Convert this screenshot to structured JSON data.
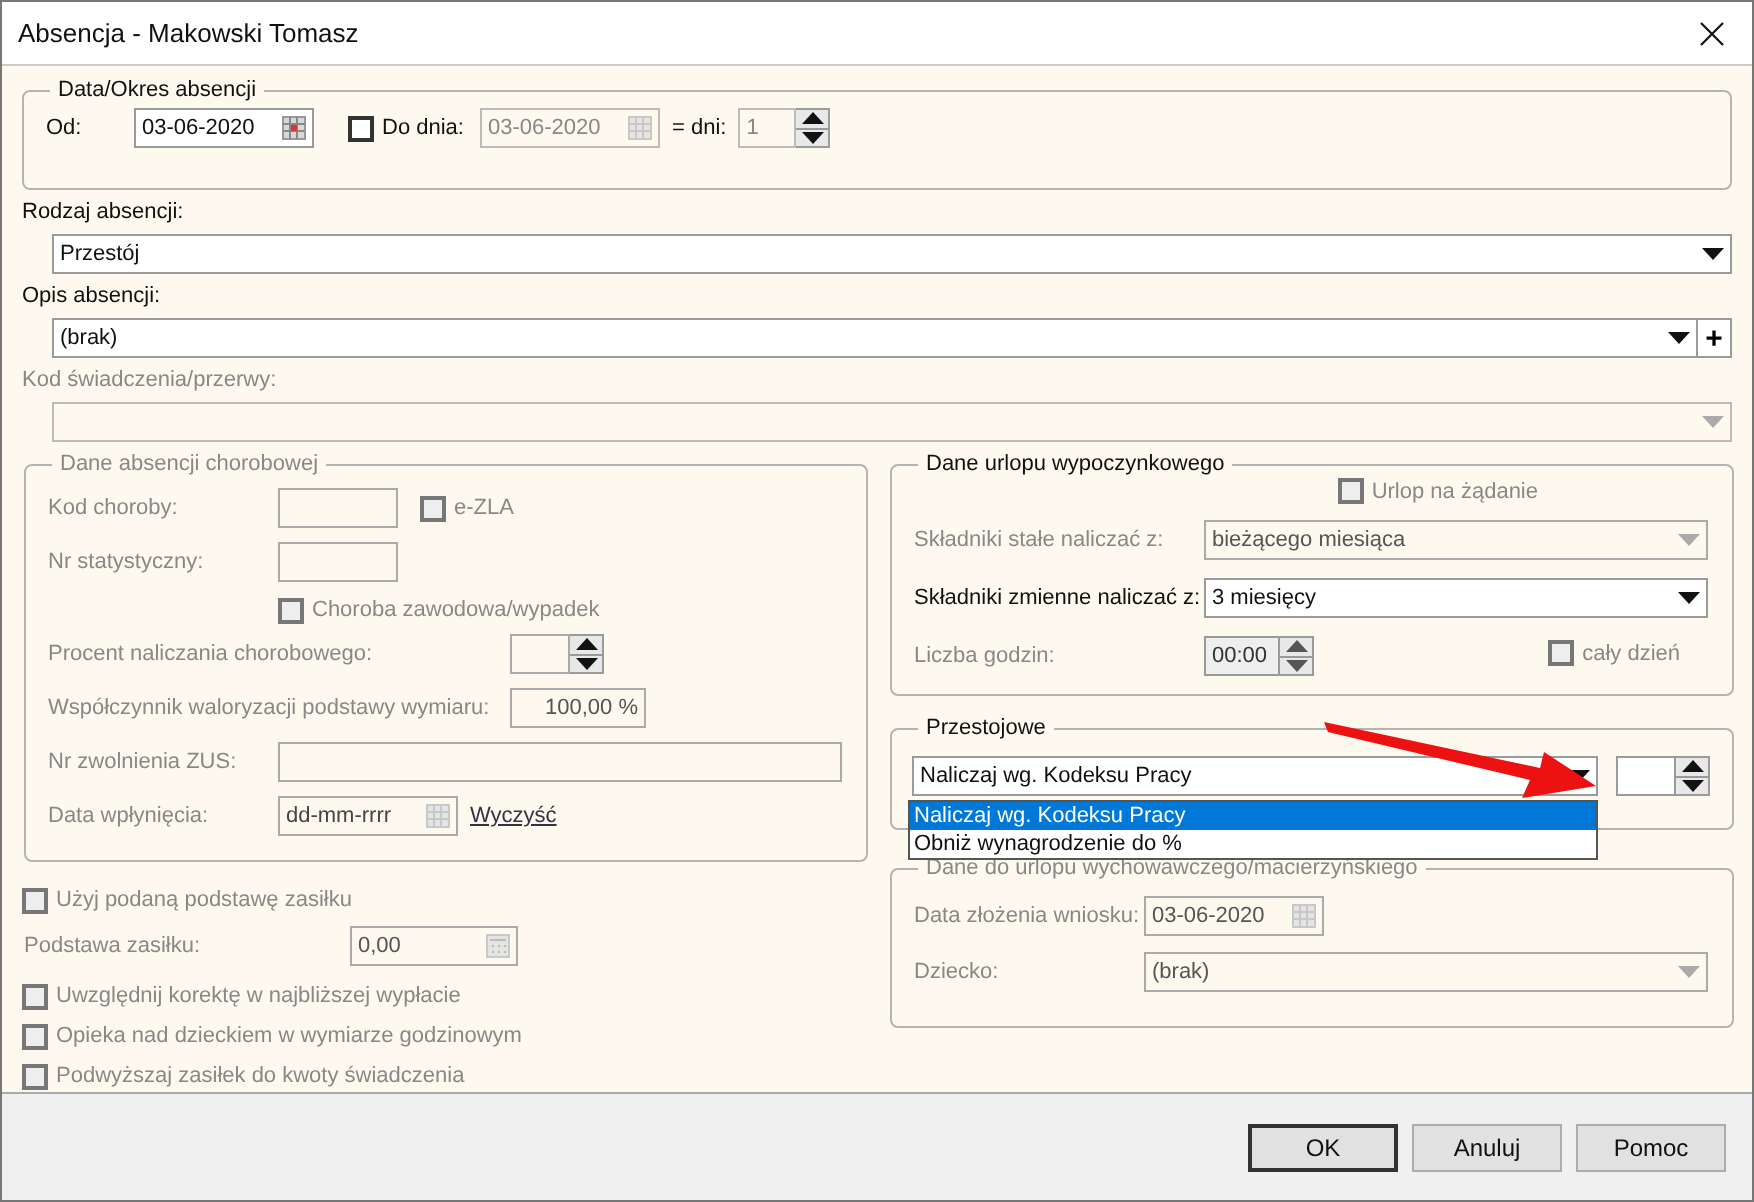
{
  "window": {
    "title": "Absencja - Makowski Tomasz"
  },
  "period": {
    "legend": "Data/Okres absencji",
    "from_label": "Od:",
    "from_value": "03-06-2020",
    "to_checkbox": {
      "label": "Do dnia:",
      "checked": false
    },
    "to_value": "03-06-2020",
    "to_disabled": true,
    "days_label": "= dni:",
    "days_value": "1"
  },
  "fields": [
    {
      "label": "Rodzaj absencji:",
      "value": "Przestój",
      "disabled": false
    },
    {
      "label": "Opis absencji:",
      "value": "(brak)",
      "disabled": false,
      "add_label": "+"
    },
    {
      "label": "Kod świadczenia/przerwy:",
      "disabled": true
    }
  ],
  "sick_leave": {
    "legend": "Dane absencji chorobowej",
    "disabled": true,
    "disease_code_label": "Kod choroby:",
    "ezla": {
      "label": "e-ZLA",
      "checked": false
    },
    "stat_no_label": "Nr statystyczny:",
    "occupational": {
      "label": "Choroba zawodowa/wypadek",
      "checked": false
    },
    "percent_label": "Procent naliczania chorobowego:",
    "valorization_label": "Współczynnik waloryzacji podstawy wymiaru:",
    "valorization_value": "100,00 %",
    "zus_label": "Nr zwolnienia ZUS:",
    "received_label": "Data wpłynięcia:",
    "received_placeholder": "dd-mm-rrrr",
    "clear_link": "Wyczyść"
  },
  "benefit": {
    "disabled": true,
    "use_base": {
      "label": "Użyj podaną podstawę zasiłku",
      "checked": false
    },
    "base_label": "Podstawa zasiłku:",
    "base_value": "0,00",
    "options": [
      {
        "label": "Uwzględnij korektę w najbliższej wypłacie",
        "checked": false
      },
      {
        "label": "Opieka nad dzieckiem w wymiarze godzinowym",
        "checked": false
      },
      {
        "label": "Podwyższaj zasiłek do kwoty świadczenia",
        "checked": false
      }
    ]
  },
  "vacation": {
    "legend": "Dane urlopu wypoczynkowego",
    "on_demand": {
      "label": "Urlop na żądanie",
      "checked": false,
      "disabled": true
    },
    "fixed": {
      "label": "Składniki stałe naliczać z:",
      "value": "bieżącego miesiąca",
      "disabled": true
    },
    "variable": {
      "label": "Składniki zmienne naliczać z:",
      "value": "3 miesięcy",
      "disabled": false
    },
    "hours": {
      "label": "Liczba godzin:",
      "value": "00:00",
      "disabled": true
    },
    "full_day": {
      "label": "cały dzień",
      "checked": false,
      "disabled": true
    }
  },
  "downtime": {
    "legend": "Przestojowe",
    "value": "Naliczaj wg. Kodeksu Pracy",
    "expanded": true,
    "options": [
      {
        "label": "Naliczaj wg. Kodeksu Pracy",
        "selected": true
      },
      {
        "label": "Obniż wynagrodzenie do %",
        "selected": false
      }
    ]
  },
  "parental": {
    "legend": "Dane do urlopu wychowawczego/macierzyńskiego",
    "disabled": true,
    "date_label": "Data złożenia wniosku:",
    "date_value": "03-06-2020",
    "child_label": "Dziecko:",
    "child_value": "(brak)"
  },
  "buttons": [
    {
      "label": "OK",
      "default": true
    },
    {
      "label": "Anuluj",
      "default": false
    },
    {
      "label": "Pomoc",
      "default": false
    }
  ]
}
